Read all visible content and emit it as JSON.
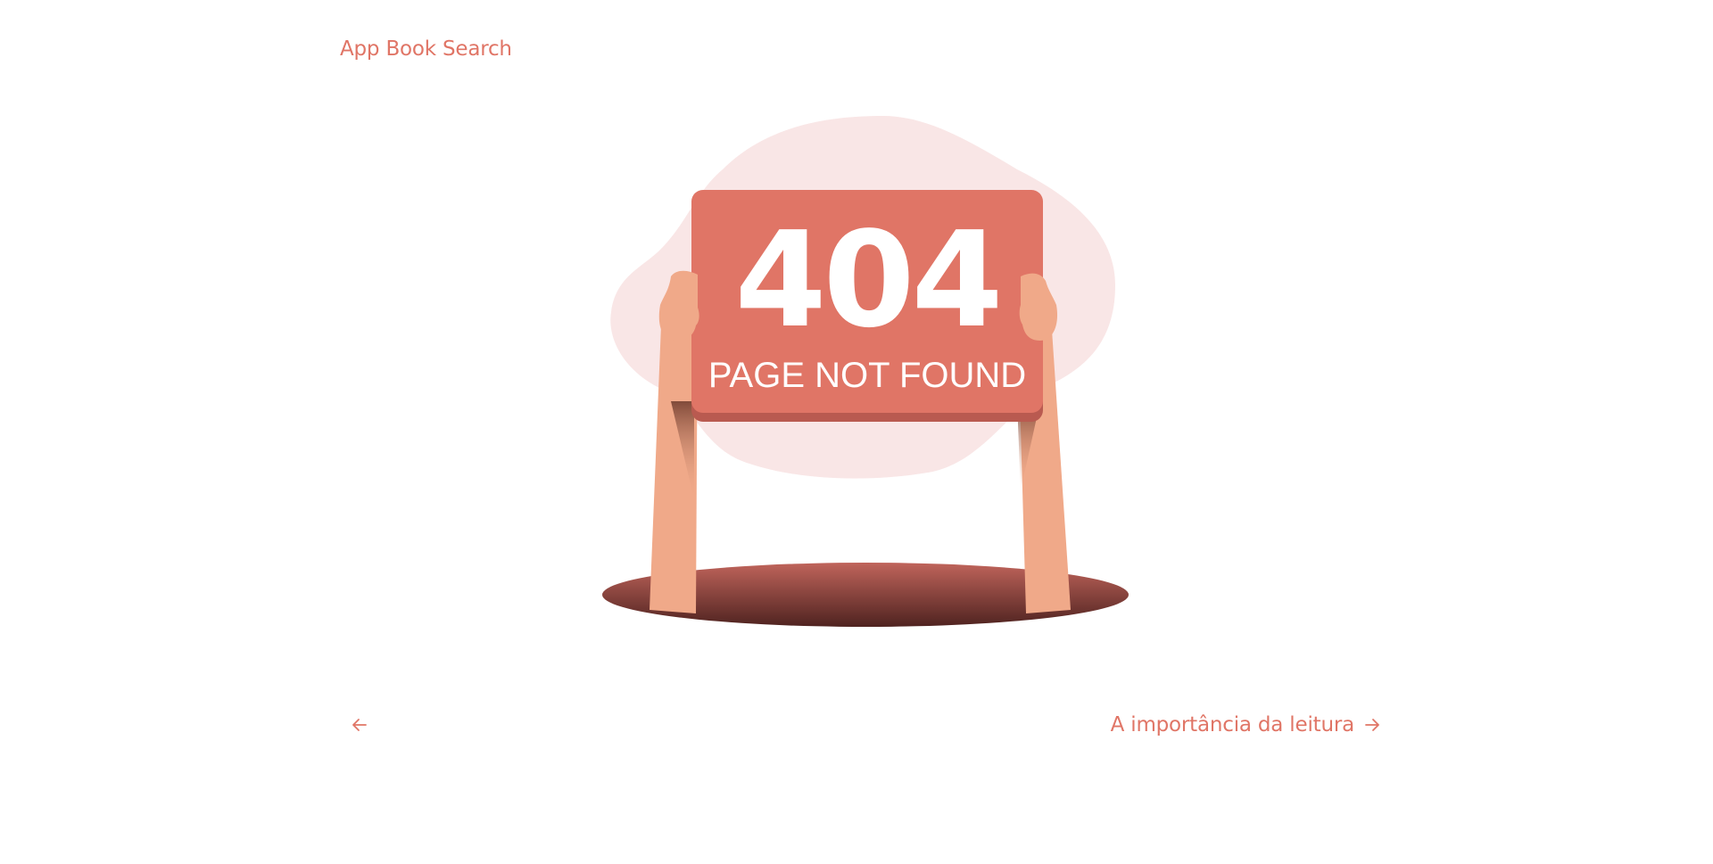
{
  "header": {
    "brand_label": "App Book Search"
  },
  "error": {
    "code": "404",
    "message": "PAGE NOT FOUND"
  },
  "navigation": {
    "prev_icon": "arrow-left-icon",
    "next_label": "A importância da leitura",
    "next_icon": "arrow-right-icon"
  },
  "colors": {
    "accent": "#e07566",
    "blob": "#f9e6e6",
    "skin": "#f0a989",
    "hole_dark": "#5c2a26"
  }
}
